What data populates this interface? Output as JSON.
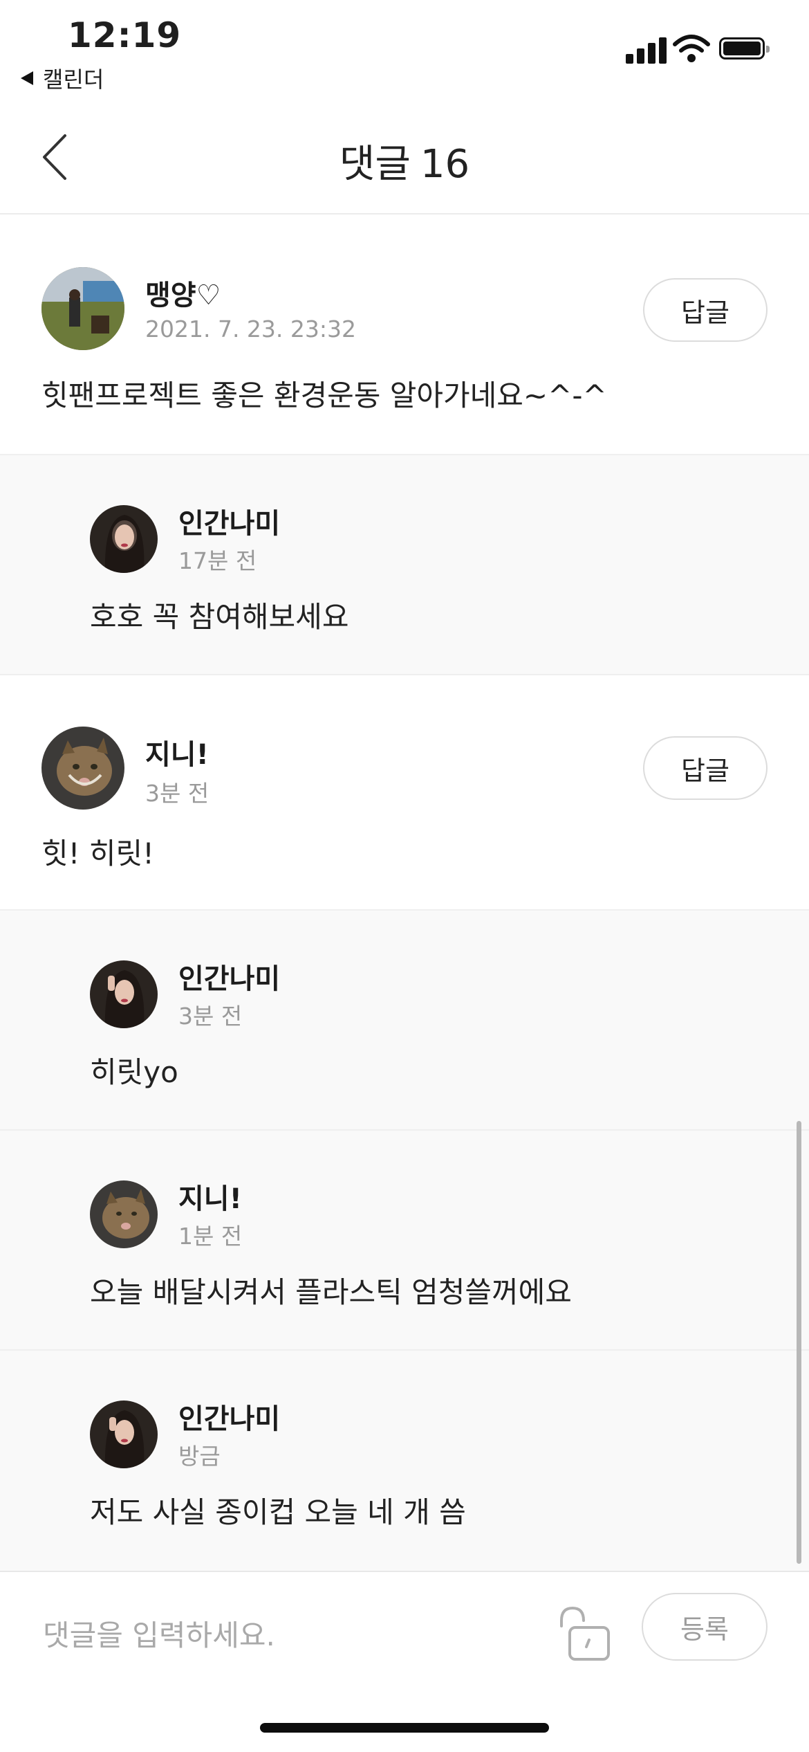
{
  "status_bar": {
    "time": "12:19",
    "back_app": "캘린더"
  },
  "header": {
    "title": "댓글",
    "count": "16"
  },
  "comments": [
    {
      "author": "맹양♡",
      "meta": "2021. 7. 23. 23:32",
      "text": "힛팬프로젝트 좋은 환경운동 알아가네요~^-^",
      "reply_label": "답글"
    },
    {
      "author": "인간나미",
      "meta": "17분 전",
      "text": "호호 꼭 참여해보세요"
    },
    {
      "author": "지니!",
      "meta": "3분 전",
      "text": "힛! 히릿!",
      "reply_label": "답글"
    },
    {
      "author": "인간나미",
      "meta": "3분 전",
      "text": "히릿yo"
    },
    {
      "author": "지니!",
      "meta": "1분 전",
      "text": "오늘 배달시켜서 플라스틱 엄청쓸꺼에요"
    },
    {
      "author": "인간나미",
      "meta": "방금",
      "text": "저도 사실 종이컵 오늘 네 개 씀"
    }
  ],
  "input": {
    "placeholder": "댓글을 입력하세요.",
    "value": "",
    "submit_label": "등록"
  },
  "icons": {
    "back": "chevron-left-icon",
    "lock": "unlock-icon"
  },
  "colors": {
    "reply_bg": "#f9f9f9",
    "meta": "#9a9a9a",
    "border": "#dcdcdc"
  }
}
